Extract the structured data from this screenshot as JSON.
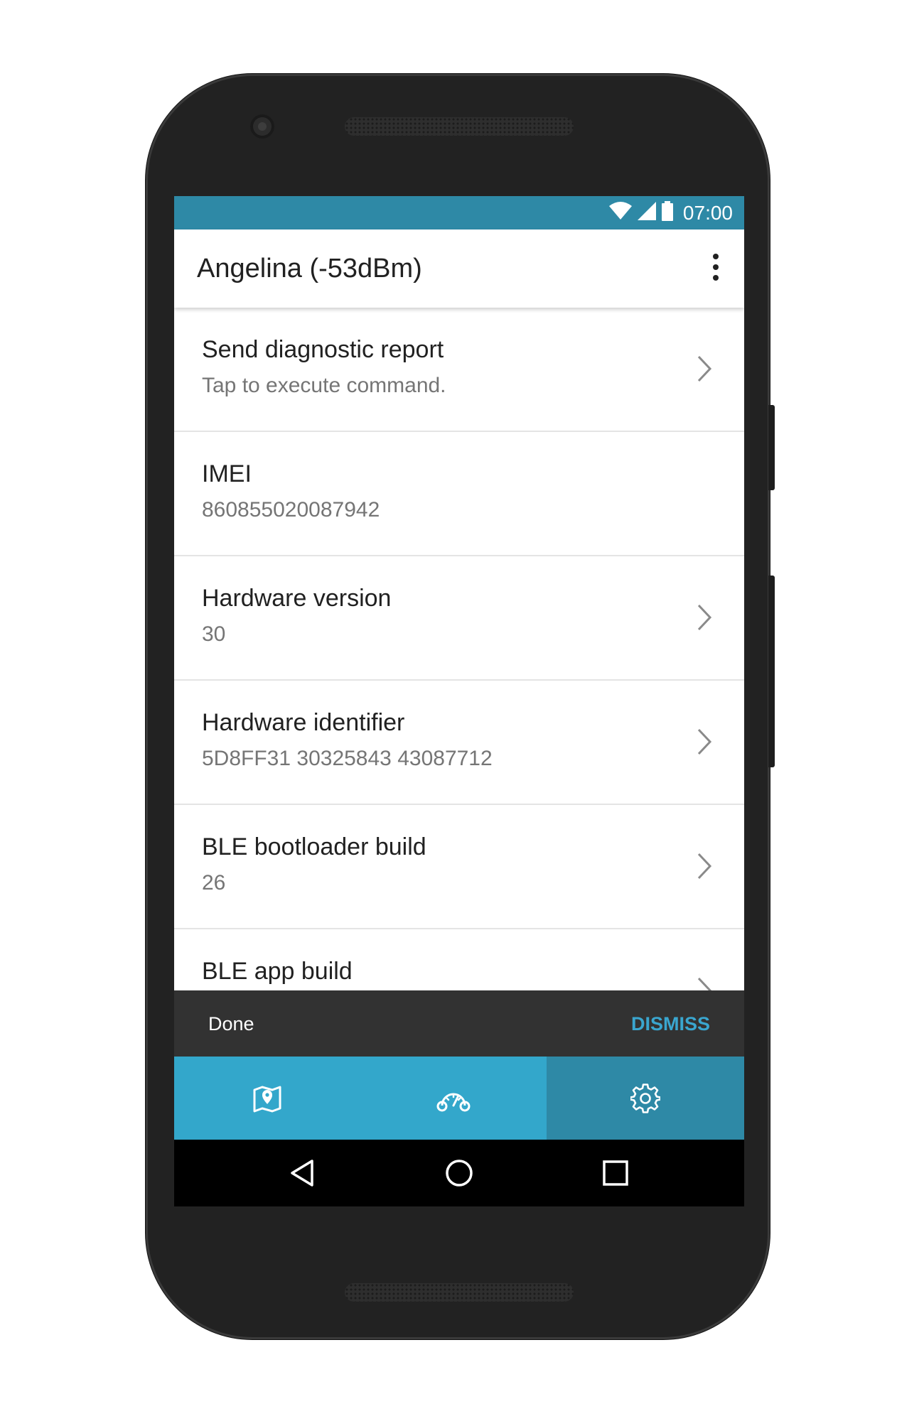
{
  "status_bar": {
    "time": "07:00",
    "icons": [
      "wifi-icon",
      "signal-icon",
      "battery-icon"
    ]
  },
  "app_bar": {
    "title": "Angelina (-53dBm)",
    "menu_icon": "more-vert-icon"
  },
  "list": {
    "items": [
      {
        "title": "Send diagnostic report",
        "subtitle": "Tap to execute command.",
        "has_chevron": true
      },
      {
        "title": "IMEI",
        "subtitle": "860855020087942",
        "has_chevron": false
      },
      {
        "title": "Hardware version",
        "subtitle": "30",
        "has_chevron": true
      },
      {
        "title": "Hardware identifier",
        "subtitle": "5D8FF31 30325843 43087712",
        "has_chevron": true
      },
      {
        "title": "BLE bootloader build",
        "subtitle": "26",
        "has_chevron": true
      },
      {
        "title": "BLE app build",
        "subtitle": "",
        "has_chevron": true
      }
    ]
  },
  "snackbar": {
    "message": "Done",
    "action": "DISMISS"
  },
  "bottom_nav": {
    "items": [
      {
        "icon": "map-pin-icon",
        "active": false
      },
      {
        "icon": "dashboard-gauge-icon",
        "active": false
      },
      {
        "icon": "settings-gear-icon",
        "active": true
      }
    ]
  },
  "system_nav": {
    "buttons": [
      "back-icon",
      "home-icon",
      "recents-icon"
    ]
  },
  "colors": {
    "status_bar": "#2e89a6",
    "bottom_nav": "#33a7cb",
    "bottom_nav_active": "#2e89a6",
    "snackbar_bg": "#323232",
    "snackbar_action": "#3aa6cf",
    "phone_body": "#222222"
  }
}
